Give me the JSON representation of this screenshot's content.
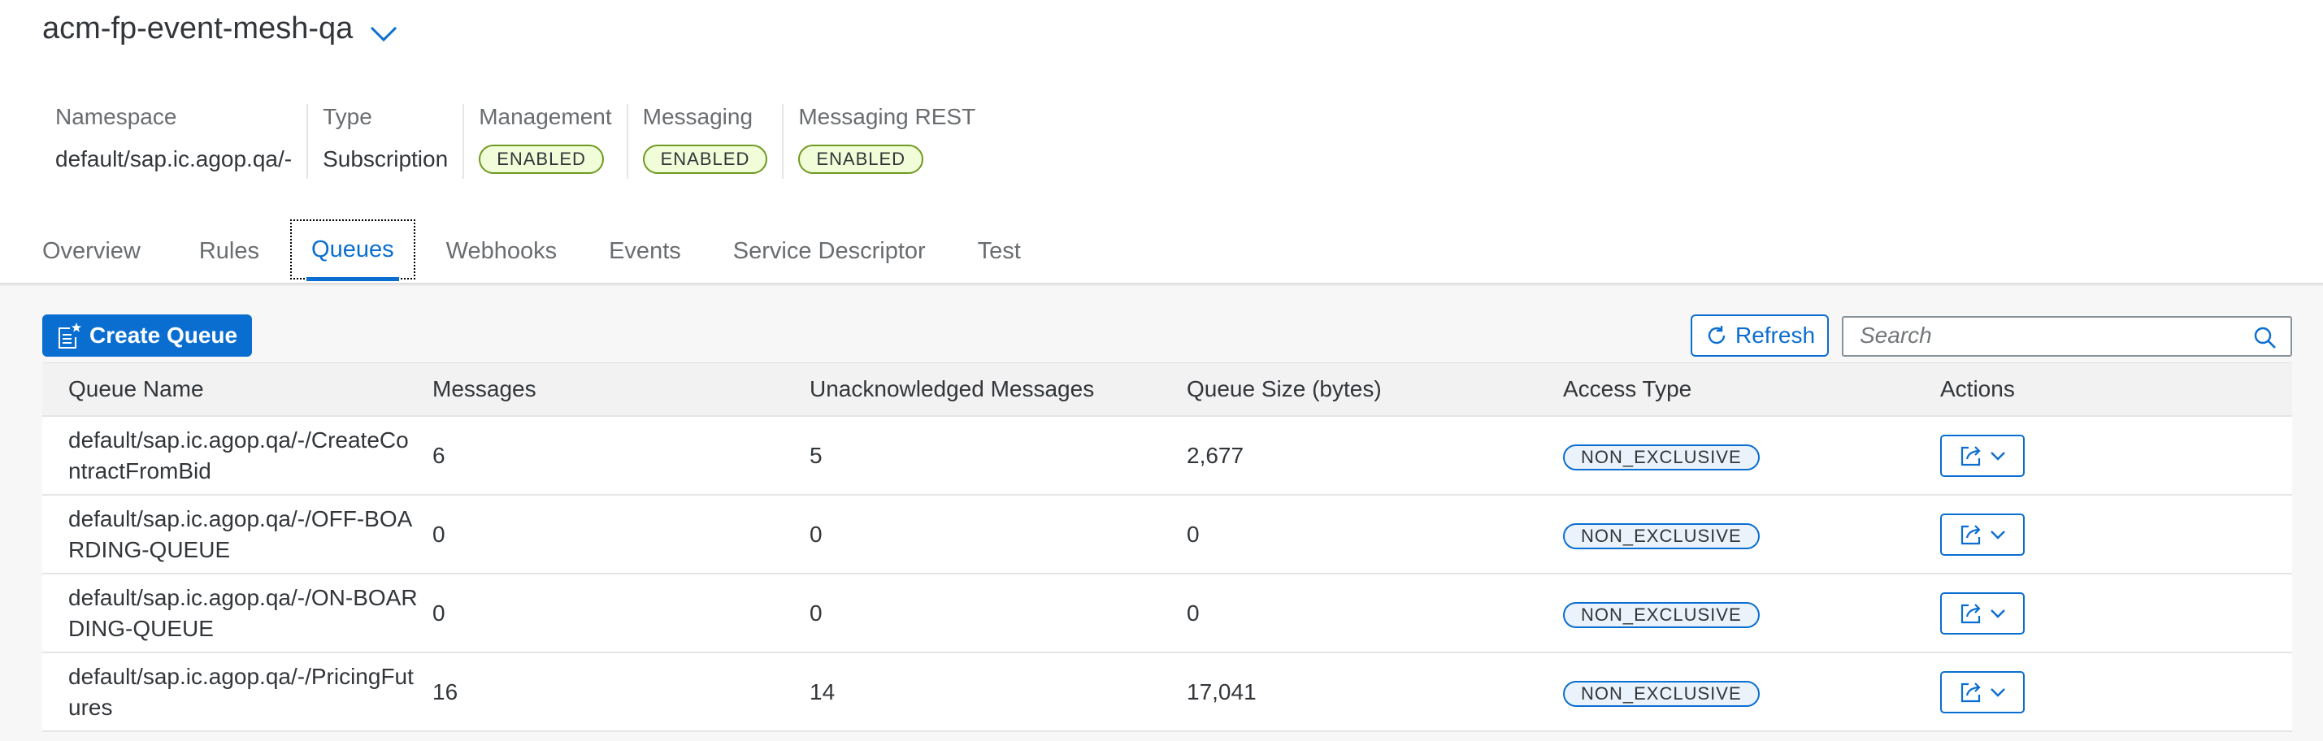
{
  "header": {
    "title": "acm-fp-event-mesh-qa",
    "attributes": [
      {
        "label": "Namespace",
        "value": "default/sap.ic.agop.qa/-"
      },
      {
        "label": "Type",
        "value": "Subscription"
      },
      {
        "label": "Management",
        "badge": "ENABLED"
      },
      {
        "label": "Messaging",
        "badge": "ENABLED"
      },
      {
        "label": "Messaging REST",
        "badge": "ENABLED"
      }
    ]
  },
  "tabs": [
    {
      "label": "Overview"
    },
    {
      "label": "Rules"
    },
    {
      "label": "Queues",
      "active": true
    },
    {
      "label": "Webhooks"
    },
    {
      "label": "Events"
    },
    {
      "label": "Service Descriptor"
    },
    {
      "label": "Test"
    }
  ],
  "toolbar": {
    "create_label": "Create Queue",
    "refresh_label": "Refresh",
    "search_placeholder": "Search"
  },
  "table": {
    "columns": [
      "Queue Name",
      "Messages",
      "Unacknowledged Messages",
      "Queue Size (bytes)",
      "Access Type",
      "Actions"
    ],
    "rows": [
      {
        "name": "default/sap.ic.agop.qa/-/CreateContractFromBid",
        "messages": "6",
        "unacked": "5",
        "size": "2,677",
        "access": "NON_EXCLUSIVE"
      },
      {
        "name": "default/sap.ic.agop.qa/-/OFF-BOARDING-QUEUE",
        "messages": "0",
        "unacked": "0",
        "size": "0",
        "access": "NON_EXCLUSIVE"
      },
      {
        "name": "default/sap.ic.agop.qa/-/ON-BOARDING-QUEUE",
        "messages": "0",
        "unacked": "0",
        "size": "0",
        "access": "NON_EXCLUSIVE"
      },
      {
        "name": "default/sap.ic.agop.qa/-/PricingFutures",
        "messages": "16",
        "unacked": "14",
        "size": "17,041",
        "access": "NON_EXCLUSIVE"
      }
    ]
  },
  "colors": {
    "accent": "#0a6ed1",
    "enabled_border": "#6f9922",
    "text": "#32363a"
  }
}
